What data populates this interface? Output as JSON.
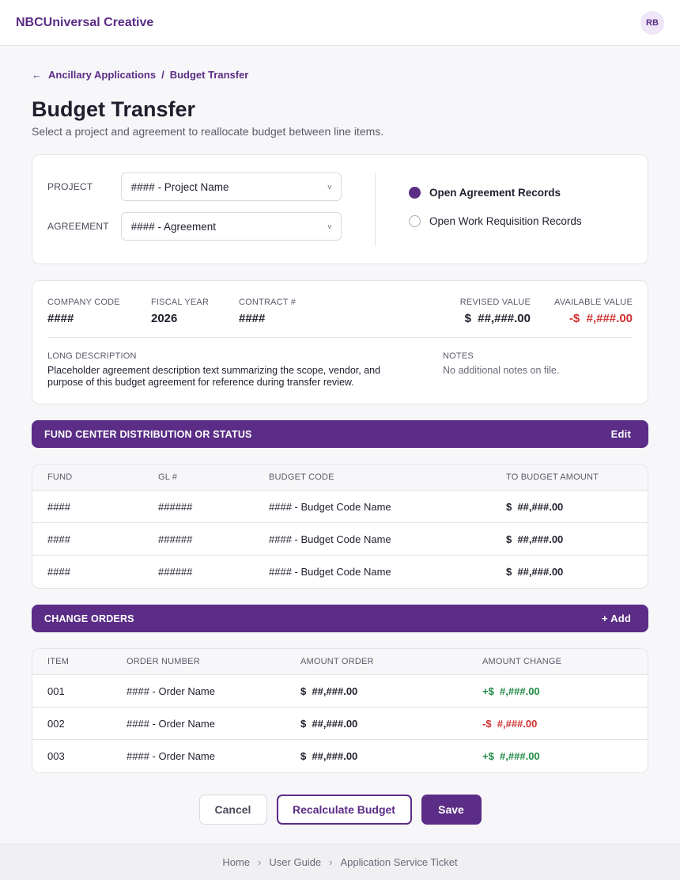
{
  "header": {
    "brand": "NBCUniversal Creative",
    "avatar_initials": "RB"
  },
  "breadcrumb": {
    "parent": "Ancillary Applications",
    "separator": "/",
    "current": "Budget Transfer"
  },
  "page": {
    "title": "Budget Transfer",
    "subtitle": "Select a project and agreement to reallocate budget between line items."
  },
  "selectors": {
    "project_label": "PROJECT",
    "project_value": "#### - Project Name",
    "agreement_label": "AGREEMENT",
    "agreement_value": "#### - Agreement",
    "radio_options": [
      "Open Agreement Records",
      "Open Work Requisition Records"
    ],
    "radio_selected": "Open Agreement Records"
  },
  "agreement_info": {
    "company_code_label": "COMPANY CODE",
    "company_code": "####",
    "fiscal_year_label": "FISCAL YEAR",
    "fiscal_year": "2026",
    "contract_label": "CONTRACT #",
    "contract": "####",
    "revised_value_label": "REVISED VALUE",
    "revised_value": "$  ##,###.00",
    "available_value_label": "AVAILABLE VALUE",
    "available_value": "-$  #,###.00",
    "long_description_label": "LONG DESCRIPTION",
    "long_description": "Placeholder agreement description text summarizing the scope, vendor, and purpose of this budget agreement for reference during transfer review.",
    "notes_label": "NOTES",
    "notes": "No additional notes on file."
  },
  "fund_section": {
    "title": "FUND CENTER DISTRIBUTION OR STATUS",
    "action": "Edit",
    "columns": [
      "FUND",
      "GL #",
      "BUDGET CODE",
      "TO BUDGET AMOUNT"
    ],
    "rows": [
      {
        "fund": "####",
        "gl": "######",
        "budget_code": "#### - Budget Code Name",
        "amount": "$  ##,###.00"
      },
      {
        "fund": "####",
        "gl": "######",
        "budget_code": "#### - Budget Code Name",
        "amount": "$  ##,###.00"
      },
      {
        "fund": "####",
        "gl": "######",
        "budget_code": "#### - Budget Code Name",
        "amount": "$  ##,###.00"
      }
    ]
  },
  "change_orders": {
    "title": "CHANGE ORDERS",
    "action": "+ Add",
    "columns": [
      "ITEM",
      "ORDER NUMBER",
      "AMOUNT ORDER",
      "AMOUNT CHANGE"
    ],
    "rows": [
      {
        "item": "001",
        "order_number": "#### - Order Name",
        "amount_order": "$  ##,###.00",
        "amount_change": "+$  #,###.00",
        "change_sign": "positive"
      },
      {
        "item": "002",
        "order_number": "#### - Order Name",
        "amount_order": "$  ##,###.00",
        "amount_change": "-$  #,###.00",
        "change_sign": "negative"
      },
      {
        "item": "003",
        "order_number": "#### - Order Name",
        "amount_order": "$  ##,###.00",
        "amount_change": "+$  #,###.00",
        "change_sign": "positive"
      }
    ]
  },
  "buttons": {
    "cancel": "Cancel",
    "recalculate": "Recalculate Budget",
    "save": "Save"
  },
  "footer": {
    "links": [
      "Home",
      "User Guide",
      "Application Service Ticket"
    ],
    "separator": "›"
  },
  "colors": {
    "brand": "#5b2d86",
    "negative": "#d03030",
    "positive": "#1f8a45"
  }
}
